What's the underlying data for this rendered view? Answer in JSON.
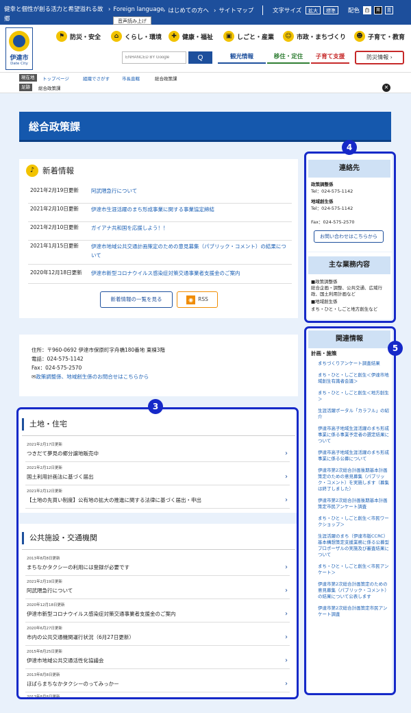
{
  "topbar": {
    "slogan": "健幸と個性が創る活力と希望溢れる故郷",
    "links": [
      "Foreign language",
      "はじめての方へ",
      "サイトマップ"
    ],
    "voice": "音声読み上げ",
    "font_label": "文字サイズ",
    "font_btns": [
      "拡大",
      "標準"
    ],
    "color_label": "配色",
    "color_btns": [
      "白",
      "黒",
      "青"
    ]
  },
  "logo": {
    "name": "伊達市",
    "en": "Date City"
  },
  "nav": [
    "防災・安全",
    "くらし・環境",
    "健康・福祉",
    "しごと・産業",
    "市政・まちづくり",
    "子育て・教育"
  ],
  "search": {
    "placeholder": "ENHANCED BY Google",
    "button": "Q"
  },
  "tabs": [
    "観光情報",
    "移住・定住",
    "子育て支援"
  ],
  "bousai": "防災情報 ›",
  "breadcrumb": {
    "here_tag": "現在地",
    "items": [
      "トップページ",
      "組織でさがす",
      "市長直轄",
      "総合政策課"
    ],
    "trail_tag": "足跡",
    "trail": "総合政策課",
    "close": "✕"
  },
  "page_title": "総合政策課",
  "news": {
    "title": "新着情報",
    "items": [
      {
        "date": "2021年2月19日更新",
        "text": "阿武隈急行について"
      },
      {
        "date": "2021年2月10日更新",
        "text": "伊達市生涯活躍のまち形成事業に関する事業協定締結"
      },
      {
        "date": "2021年2月10日更新",
        "text": "ガイアナ共和国を応援しよう！！"
      },
      {
        "date": "2021年1月15日更新",
        "text": "伊達市地域公共交通計画策定のための意見募集（パブリック・コメント）の結果について"
      },
      {
        "date": "2020年12月18日更新",
        "text": "伊達市新型コロナウイルス感染症対策交通事業者支援金のご案内"
      }
    ],
    "list_button": "新着情報の一覧を見る",
    "rss": "RSS"
  },
  "address": {
    "line1": "住所：〒960-0692 伊達市保原町字舟橋180番地 東棟3階",
    "tel": "電話：024-575-1142",
    "fax": "Fax：024-575-2570",
    "link": "政策調整係、地域創生係のお問合せはこちらから"
  },
  "section1": {
    "title": "土地・住宅",
    "items": [
      {
        "date": "2021年2月17日更新",
        "text": "つきだて夢見の郷分譲地販売中"
      },
      {
        "date": "2021年2月12日更新",
        "text": "国土利用計画法に基づく届出"
      },
      {
        "date": "2021年2月12日更新",
        "text": "【土地の先買い制度】公有地の拡大の推進に関する法律に基づく届出・申出"
      }
    ]
  },
  "section2": {
    "title": "公共施設・交通機関",
    "items": [
      {
        "date": "2013年8月8日更新",
        "text": "まちなかタクシーの利用には登録が必要です"
      },
      {
        "date": "2021年2月19日更新",
        "text": "阿武隈急行について"
      },
      {
        "date": "2020年12月18日更新",
        "text": "伊達市新型コロナウイルス感染症対策交通事業者支援金のご案内"
      },
      {
        "date": "2020年6月27日更新",
        "text": "市内の公共交通機関運行状況（6月27日更新）"
      },
      {
        "date": "2015年8月25日更新",
        "text": "伊達市地域公共交通活性化協議会"
      },
      {
        "date": "2013年8月8日更新",
        "text": "ほばらまちなかタクシーのってみっかー"
      },
      {
        "date": "2013年8月8日更新",
        "text": ""
      }
    ]
  },
  "contact": {
    "title": "連絡先",
    "g1_name": "政策調整係",
    "g1_tel": "Tel：024-575-1142",
    "g2_name": "地域創生係",
    "g2_tel": "Tel：024-575-1142",
    "fax": "Fax：024-575-2570",
    "button": "お問い合わせはこちらから"
  },
  "business": {
    "title": "主な業務内容",
    "l1": "■政策調整係",
    "l2": "総合企画・調整、公共交通、広域行政、国土利用計画など",
    "l3": "■地域創生係",
    "l4": "まち・ひと・しごと地方創生など"
  },
  "related": {
    "title": "関連情報",
    "sub": "計画・施策",
    "links": [
      "まちづくりアンケート調査結果",
      "まち・ひと・しごと創生＜伊達市地域創生有識者会議＞",
      "まち・ひと・しごと創生＜地方創生＞",
      "生涯活躍ポータル「カラフル」の紹介",
      "伊達市高子地域生涯活躍のまち形成事業に係る事業予定者の選定結果について",
      "伊達市高子地域生涯活躍のまち形成事業に係る公募について",
      "伊達市第2次総合計画後期基本計画策定のための意見募集（パブリック・コメント）を実施します（募集は終了しました）",
      "伊達市第2次総合計画後期基本計画策定市民アンケート調査",
      "まち・ひと・しごと創生＜市民ワークショップ＞",
      "生涯活躍のまち（伊達市版CCRC）基本構想策定支援業務に係る公募型プロポーザルの実施及び審査結果について",
      "まち・ひと・しごと創生＜市民アンケート＞",
      "伊達市第2次総合計画策定のための意見募集（パブリック・コメント）の結果について公表します",
      "伊達市第2次総合計画策定市民アンケート調査"
    ]
  },
  "annotations": [
    "3",
    "4",
    "5"
  ]
}
